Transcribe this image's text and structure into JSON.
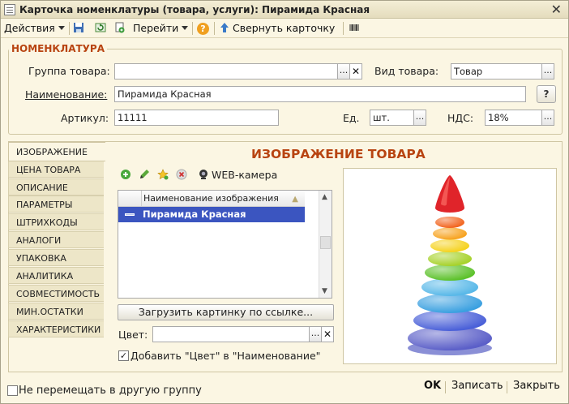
{
  "window": {
    "title": "Карточка номенклатуры (товара, услуги): Пирамида Красная"
  },
  "toolbar": {
    "actions_label": "Действия",
    "goto_label": "Перейти",
    "help_label": "?",
    "collapse_label": "Свернуть карточку"
  },
  "group": {
    "title": "НОМЕНКЛАТУРА",
    "product_group_label": "Группа товара:",
    "product_group_value": "",
    "product_type_label": "Вид товара:",
    "product_type_value": "Товар",
    "name_label": "Наименование:",
    "name_value": "Пирамида Красная",
    "article_label": "Артикул:",
    "article_value": "11111",
    "unit_label": "Ед.",
    "unit_value": "шт.",
    "vat_label": "НДС:",
    "vat_value": "18%"
  },
  "tabs": [
    {
      "label": "ИЗОБРАЖЕНИЕ"
    },
    {
      "label": "ЦЕНА ТОВАРА"
    },
    {
      "label": "ОПИСАНИЕ"
    },
    {
      "label": "ПАРАМЕТРЫ"
    },
    {
      "label": "ШТРИХКОДЫ"
    },
    {
      "label": "АНАЛОГИ"
    },
    {
      "label": "УПАКОВКА"
    },
    {
      "label": "АНАЛИТИКА"
    },
    {
      "label": "СОВМЕСТИМОСТЬ"
    },
    {
      "label": "МИН.ОСТАТКИ"
    },
    {
      "label": "ХАРАКТЕРИСТИКИ"
    }
  ],
  "image_tab": {
    "heading": "ИЗОБРАЖЕНИЕ ТОВАРА",
    "webcam_label": "WEB-камера",
    "column_header": "Наименование изображения",
    "rows": [
      "Пирамида Красная"
    ],
    "load_button": "Загрузить картинку по ссылке...",
    "color_label": "Цвет:",
    "color_value": "",
    "add_color_label": "Добавить \"Цвет\" в \"Наименование\"",
    "add_color_checked": true
  },
  "footer": {
    "dont_move_label": "Не перемещать в другую группу",
    "dont_move_checked": false,
    "ok_label": "OK",
    "save_label": "Записать",
    "close_label": "Закрыть"
  },
  "colors": {
    "accent": "#b84411",
    "selection": "#3b55c0",
    "background": "#fbf6e3"
  }
}
